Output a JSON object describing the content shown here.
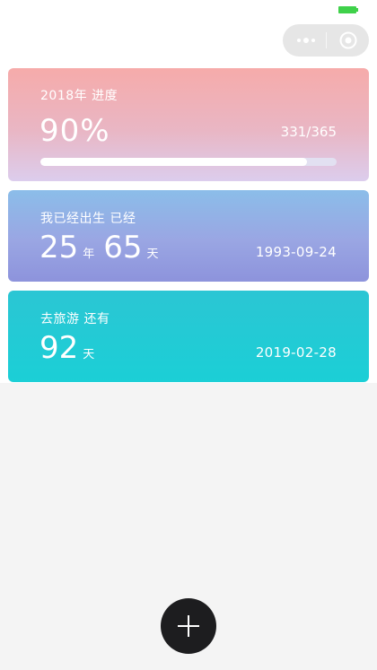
{
  "status_bar": {
    "battery_color": "#3fd14a"
  },
  "capsule": {
    "more_icon": "more-dots-icon",
    "close_icon": "target-circle-icon"
  },
  "cards": {
    "progress": {
      "title": "2018年 进度",
      "percent": "90%",
      "fraction": "331/365",
      "progress_value": 0.9
    },
    "born": {
      "title": "我已经出生 已经",
      "years": "25",
      "years_unit": "年",
      "days": "65",
      "days_unit": "天",
      "date": "1993-09-24"
    },
    "travel": {
      "title": "去旅游 还有",
      "days": "92",
      "days_unit": "天",
      "date": "2019-02-28"
    }
  },
  "fab": {
    "icon": "plus-icon"
  },
  "colors": {
    "progress_top": "#f6abaa",
    "born_top": "#8bbde9",
    "travel": "#1bcfd6",
    "fab": "#1d1d1f"
  }
}
